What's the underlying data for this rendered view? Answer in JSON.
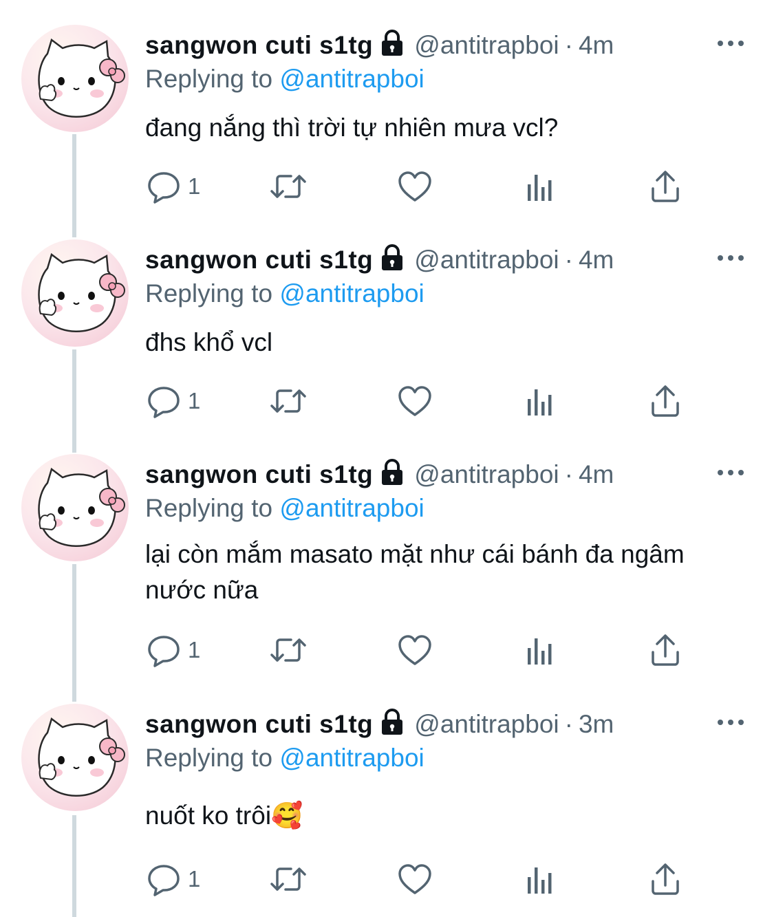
{
  "tweets": [
    {
      "name": "sangwon cuti s1tg",
      "handle": "@antitrapboi",
      "dot": "·",
      "time": "4m",
      "replying_prefix": "Replying to ",
      "replying_to": "@antitrapboi",
      "text": "đang nắng thì trời tự nhiên mưa vcl?",
      "reply_count": "1"
    },
    {
      "name": "sangwon cuti s1tg",
      "handle": "@antitrapboi",
      "dot": "·",
      "time": "4m",
      "replying_prefix": "Replying to ",
      "replying_to": "@antitrapboi",
      "text": "đhs khổ vcl",
      "reply_count": "1"
    },
    {
      "name": "sangwon cuti s1tg",
      "handle": "@antitrapboi",
      "dot": "·",
      "time": "4m",
      "replying_prefix": "Replying to ",
      "replying_to": "@antitrapboi",
      "text": "lại còn mắm masato mặt như cái bánh đa ngâm nước nữa",
      "reply_count": "1"
    },
    {
      "name": "sangwon cuti s1tg",
      "handle": "@antitrapboi",
      "dot": "·",
      "time": "3m",
      "replying_prefix": "Replying to ",
      "replying_to": "@antitrapboi",
      "text": "nuốt ko trôi🥰",
      "reply_count": "1"
    }
  ],
  "icons": {
    "avatar": "hello-kitty-avatar",
    "lock": "lock-icon",
    "more": "more-icon",
    "reply": "reply-icon",
    "retweet": "retweet-icon",
    "like": "like-icon",
    "views": "views-icon",
    "share": "share-icon"
  },
  "colors": {
    "text": "#0f1419",
    "secondary": "#536471",
    "link": "#1d9bf0",
    "thread_line": "#cfd9de"
  }
}
